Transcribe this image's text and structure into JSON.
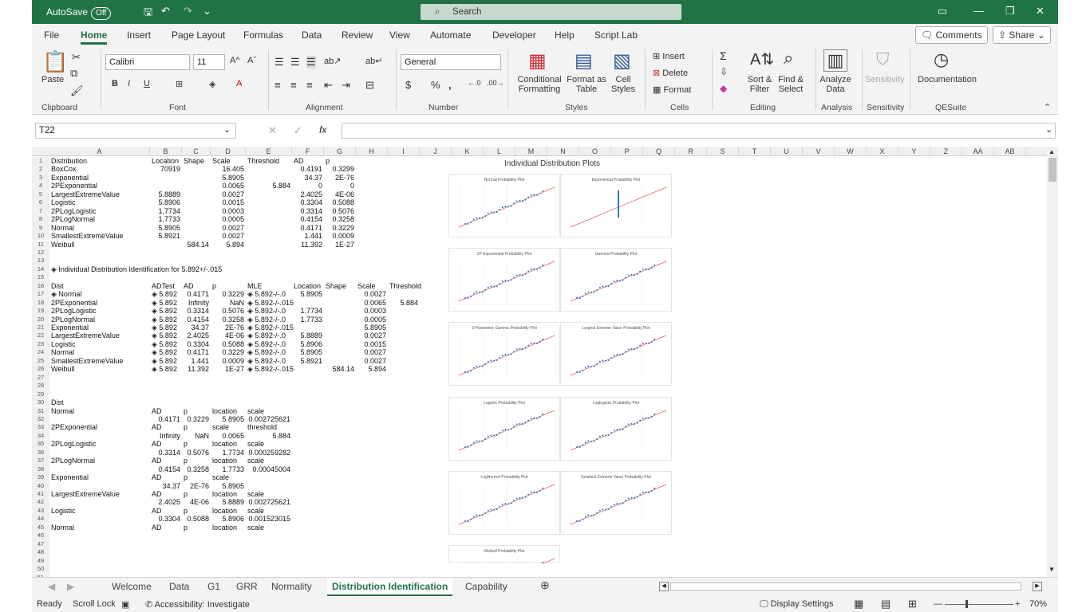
{
  "titlebar": {
    "autosave_label": "AutoSave",
    "autosave_state": "Off",
    "search_placeholder": "Search"
  },
  "ribbon_tabs": [
    "File",
    "Home",
    "Insert",
    "Page Layout",
    "Formulas",
    "Data",
    "Review",
    "View",
    "Automate",
    "Developer",
    "Help",
    "Script Lab"
  ],
  "active_tab": "Home",
  "header_buttons": {
    "comments": "Comments",
    "share": "Share"
  },
  "ribbon": {
    "paste": "Paste",
    "font_name": "Calibri",
    "font_size": "11",
    "number_format": "General",
    "conditional": [
      "Conditional",
      "Formatting"
    ],
    "format_as": [
      "Format as",
      "Table"
    ],
    "cell_styles": [
      "Cell",
      "Styles"
    ],
    "insert": "Insert",
    "delete": "Delete",
    "format": "Format",
    "sort": [
      "Sort &",
      "Filter"
    ],
    "find": [
      "Find &",
      "Select"
    ],
    "analyze": [
      "Analyze",
      "Data"
    ],
    "sensitivity": "Sensitivity",
    "documentation": "Documentation",
    "groups": [
      "Clipboard",
      "Font",
      "Alignment",
      "Number",
      "Styles",
      "Cells",
      "Editing",
      "Analysis",
      "Sensitivity",
      "QESuite"
    ]
  },
  "formula_bar": {
    "name_box": "T22",
    "fx": "fx"
  },
  "columns": [
    "A",
    "B",
    "C",
    "D",
    "E",
    "F",
    "G",
    "H",
    "I",
    "J",
    "K",
    "L",
    "M",
    "N",
    "O",
    "P",
    "Q",
    "R",
    "S",
    "T",
    "U",
    "V",
    "W",
    "X",
    "Y",
    "Z",
    "AA",
    "AB"
  ],
  "table1": {
    "headers": [
      "Distribution",
      "Location",
      "Shape",
      "Scale",
      "Threshold",
      "AD",
      "p"
    ],
    "rows": [
      [
        "BoxCox",
        "70919",
        "",
        "16.405",
        "",
        "0.4191",
        "0.3299"
      ],
      [
        "Exponential",
        "",
        "",
        "5.8905",
        "",
        "34.37",
        "2E-76"
      ],
      [
        "2PExponential",
        "",
        "",
        "0.0065",
        "5.884",
        "0",
        "0"
      ],
      [
        "LargestExtremeValue",
        "5.8889",
        "",
        "0.0027",
        "",
        "2.4025",
        "4E-06"
      ],
      [
        "Logistic",
        "5.8906",
        "",
        "0.0015",
        "",
        "0.3304",
        "0.5088"
      ],
      [
        "2PLogLogistic",
        "1.7734",
        "",
        "0.0003",
        "",
        "0.3314",
        "0.5076"
      ],
      [
        "2PLogNormal",
        "1.7733",
        "",
        "0.0005",
        "",
        "0.4154",
        "0.3258"
      ],
      [
        "Normal",
        "5.8905",
        "",
        "0.0027",
        "",
        "0.4171",
        "0.3229"
      ],
      [
        "SmallestExtremeValue",
        "5.8921",
        "",
        "0.0027",
        "",
        "1.441",
        "0.0009"
      ],
      [
        "Weibull",
        "",
        "584.14",
        "5.894",
        "",
        "11.392",
        "1E-27"
      ]
    ]
  },
  "section_title": "Individual Distribution Identification for 5.892+/-.015",
  "table2": {
    "headers": [
      "Dist",
      "ADTest",
      "AD",
      "p",
      "MLE",
      "Location",
      "Shape",
      "Scale",
      "Threshold"
    ],
    "rows": [
      [
        "Normal",
        "5.892",
        "0.4171",
        "0.3229",
        "5.892-/-.0",
        "5.8905",
        "",
        "0.0027",
        ""
      ],
      [
        "2PExponential",
        "5.892",
        "Infinity",
        "NaN",
        "5.892-/-.015",
        "",
        "",
        "0.0065",
        "5.884"
      ],
      [
        "2PLogLogistic",
        "5.892",
        "0.3314",
        "0.5076",
        "5.892-/-.0",
        "1.7734",
        "",
        "0.0003",
        ""
      ],
      [
        "2PLogNormal",
        "5.892",
        "0.4154",
        "0.3258",
        "5.892-/-.0",
        "1.7733",
        "",
        "0.0005",
        ""
      ],
      [
        "Exponential",
        "5.892",
        "34.37",
        "2E-76",
        "5.892-/-.015",
        "",
        "",
        "5.8905",
        ""
      ],
      [
        "LargestExtremeValue",
        "5.892",
        "2.4025",
        "4E-06",
        "5.892-/-.0",
        "5.8889",
        "",
        "0.0027",
        ""
      ],
      [
        "Logistic",
        "5.892",
        "0.3304",
        "0.5088",
        "5.892-/-.0",
        "5.8906",
        "",
        "0.0015",
        ""
      ],
      [
        "Normal",
        "5.892",
        "0.4171",
        "0.3229",
        "5.892-/-.0",
        "5.8905",
        "",
        "0.0027",
        ""
      ],
      [
        "SmallestExtremeValue",
        "5.892",
        "1.441",
        "0.0009",
        "5.892-/-.0",
        "5.8921",
        "",
        "0.0027",
        ""
      ],
      [
        "Weibull",
        "5.892",
        "11.392",
        "1E-27",
        "5.892-/-.015",
        "",
        "584.14",
        "5.894",
        ""
      ]
    ]
  },
  "table3": [
    {
      "row": 30,
      "cells": [
        "Dist",
        "",
        "",
        "",
        ""
      ]
    },
    {
      "row": 31,
      "cells": [
        "Normal",
        "AD",
        "p",
        "location",
        "scale"
      ]
    },
    {
      "row": 32,
      "cells": [
        "",
        "0.4171",
        "0.3229",
        "5.8905",
        "0.002725621"
      ]
    },
    {
      "row": 33,
      "cells": [
        "2PExponential",
        "AD",
        "p",
        "scale",
        "threshold"
      ]
    },
    {
      "row": 34,
      "cells": [
        "",
        "Infinity",
        "NaN",
        "0.0065",
        "5.884"
      ]
    },
    {
      "row": 35,
      "cells": [
        "2PLogLogistic",
        "AD",
        "p",
        "location",
        "scale"
      ]
    },
    {
      "row": 36,
      "cells": [
        "",
        "0.3314",
        "0.5076",
        "1.7734",
        "0.000259282"
      ]
    },
    {
      "row": 37,
      "cells": [
        "2PLogNormal",
        "AD",
        "p",
        "location",
        "scale"
      ]
    },
    {
      "row": 38,
      "cells": [
        "",
        "0.4154",
        "0.3258",
        "1.7733",
        "0.00045004"
      ]
    },
    {
      "row": 39,
      "cells": [
        "Exponential",
        "AD",
        "p",
        "scale",
        ""
      ]
    },
    {
      "row": 40,
      "cells": [
        "",
        "34.37",
        "2E-76",
        "5.8905",
        ""
      ]
    },
    {
      "row": 41,
      "cells": [
        "LargestExtremeValue",
        "AD",
        "p",
        "location",
        "scale"
      ]
    },
    {
      "row": 42,
      "cells": [
        "",
        "2.4025",
        "4E-06",
        "5.8889",
        "0.002725621"
      ]
    },
    {
      "row": 43,
      "cells": [
        "Logistic",
        "AD",
        "p",
        "location",
        "scale"
      ]
    },
    {
      "row": 44,
      "cells": [
        "",
        "0.3304",
        "0.5088",
        "5.8906",
        "0.001523015"
      ]
    },
    {
      "row": 45,
      "cells": [
        "Normal",
        "AD",
        "p",
        "location",
        "scale"
      ]
    }
  ],
  "plots_title": "Individual Distribution Plots",
  "plots": [
    "Normal Probability Plot",
    "Exponential Probability Plot",
    "2P Exponential Probability Plot",
    "Gamma Probability Plot",
    "3-Parameter Gamma Probability Plot",
    "Largest Extreme Value Probability Plot",
    "Logistic Probability Plot",
    "Loglogistic Probability Plot",
    "LogNormal Probability Plot",
    "Smallest Extreme Value Probability Plot",
    "Weibull Probability Plot"
  ],
  "sheet_tabs": [
    "Welcome",
    "Data",
    "G1",
    "GRR",
    "Normality",
    "Distribution Identification",
    "Capability"
  ],
  "active_sheet": "Distribution Identification",
  "status": {
    "ready": "Ready",
    "scroll_lock": "Scroll Lock",
    "accessibility": "Accessibility: Investigate",
    "display_settings": "Display Settings",
    "zoom": "70%"
  },
  "colors": {
    "excel_green": "#217346",
    "plot_line": "#e06060",
    "plot_points": "#2b7bb9"
  }
}
